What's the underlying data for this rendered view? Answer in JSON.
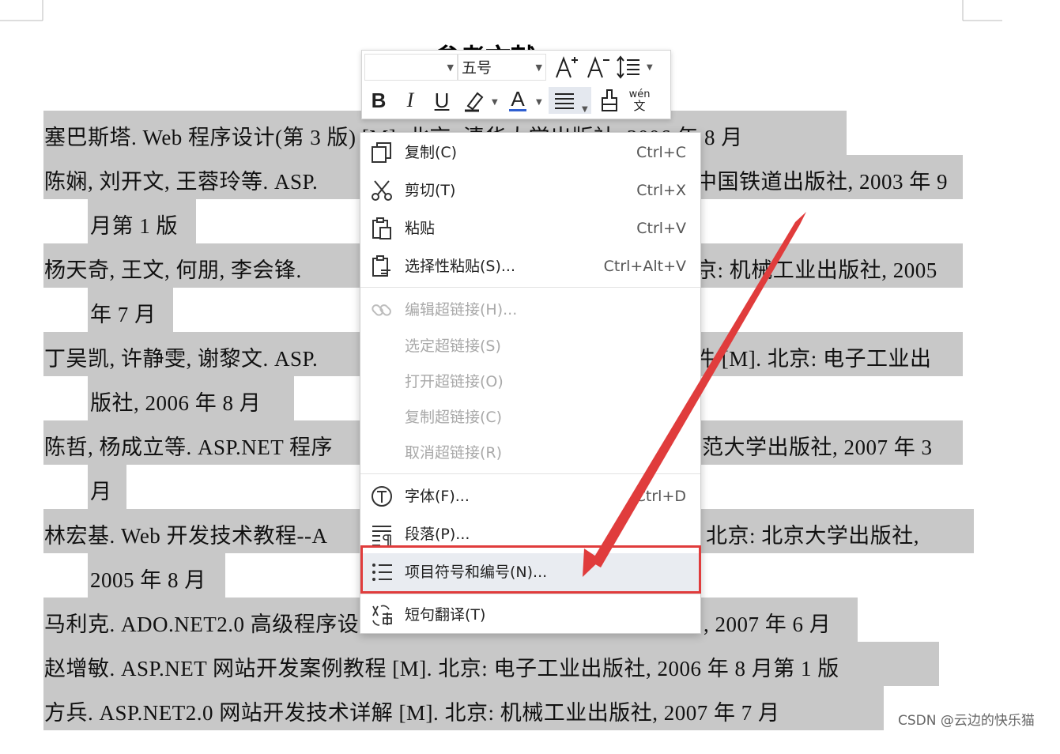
{
  "document": {
    "title": "参考文献",
    "lines": [
      "塞巴斯塔. Web 程序设计(第 3 版) [M]. 北京: 清华大学出版社, 2006 年 8 月",
      "陈娴, 刘开文, 王蓉玲等. ASP.",
      "中国铁道出版社, 2003 年 9",
      "月第 1 版",
      "杨天奇, 王文, 何朋, 李会锋.",
      "京: 机械工业出版社, 2005",
      "年 7 月",
      "丁吴凯, 许静雯, 谢黎文. ASP.",
      "件 [M]. 北京: 电子工业出",
      "版社, 2006 年 8 月",
      "陈哲, 杨成立等. ASP.NET 程序",
      "范大学出版社, 2007 年 3",
      "月",
      "林宏基. Web 开发技术教程--A",
      "北京: 北京大学出版社,",
      "2005 年 8 月",
      "马利克. ADO.NET2.0 高级程序设",
      ", 2007 年 6 月",
      "赵增敏. ASP.NET 网站开发案例教程 [M]. 北京: 电子工业出版社, 2006 年 8 月第 1 版",
      "方兵. ASP.NET2.0 网站开发技术详解 [M]. 北京: 机械工业出版社, 2007 年 7 月"
    ]
  },
  "toolbar": {
    "font_name": "",
    "font_size": "五号",
    "buttons": [
      "grow-font-icon",
      "shrink-font-icon",
      "line-spacing-icon",
      "bold-icon",
      "italic-icon",
      "underline-icon",
      "highlight-icon",
      "font-color-icon",
      "align-icon",
      "format-painter-icon",
      "pinyin-icon"
    ],
    "bold": "B",
    "italic": "I",
    "underline": "U",
    "font_color_letter": "A",
    "pinyin_top": "wén",
    "pinyin_bottom": "文",
    "font_color": "#2f5fd1"
  },
  "context_menu": {
    "items": [
      {
        "label": "复制(C)",
        "shortcut": "Ctrl+C",
        "icon": "copy-icon"
      },
      {
        "label": "剪切(T)",
        "shortcut": "Ctrl+X",
        "icon": "cut-icon"
      },
      {
        "label": "粘贴",
        "shortcut": "Ctrl+V",
        "icon": "paste-icon"
      },
      {
        "label": "选择性粘贴(S)...",
        "shortcut": "Ctrl+Alt+V",
        "icon": "paste-special-icon"
      },
      {
        "label": "编辑超链接(H)...",
        "shortcut": "",
        "icon": "link-icon",
        "disabled": true
      },
      {
        "label": "选定超链接(S)",
        "shortcut": "",
        "disabled": true
      },
      {
        "label": "打开超链接(O)",
        "shortcut": "",
        "disabled": true
      },
      {
        "label": "复制超链接(C)",
        "shortcut": "",
        "disabled": true
      },
      {
        "label": "取消超链接(R)",
        "shortcut": "",
        "disabled": true
      },
      {
        "label": "字体(F)...",
        "shortcut": "Ctrl+D",
        "icon": "font-icon"
      },
      {
        "label": "段落(P)...",
        "shortcut": "",
        "icon": "paragraph-icon"
      },
      {
        "label": "项目符号和编号(N)...",
        "shortcut": "",
        "icon": "bullets-icon",
        "highlighted": true
      },
      {
        "label": "短句翻译(T)",
        "shortcut": "",
        "icon": "translate-icon"
      }
    ]
  },
  "annotation": {
    "color": "#e03c3c"
  },
  "watermark": "CSDN @云边的快乐猫"
}
